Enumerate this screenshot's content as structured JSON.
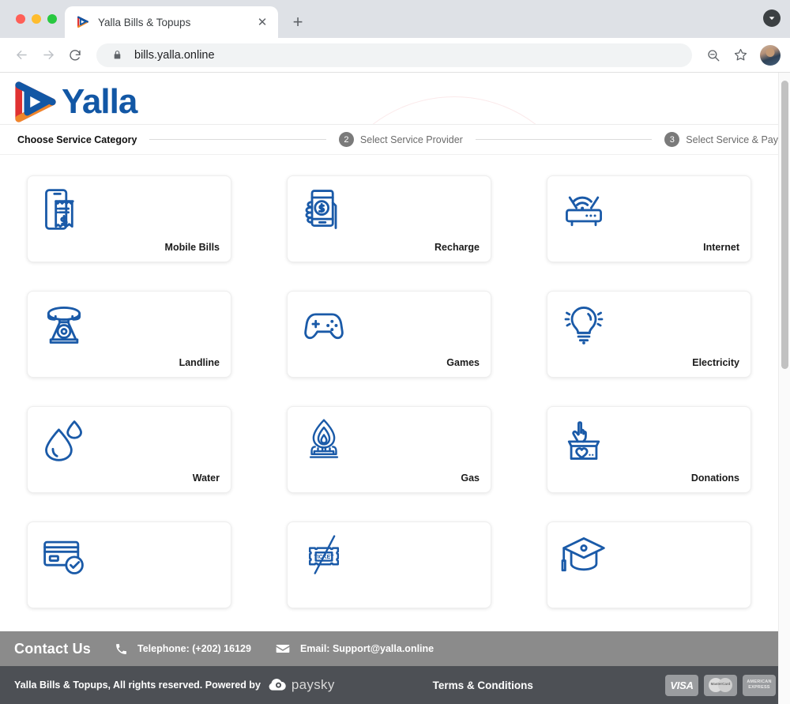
{
  "browser": {
    "tab": {
      "title": "Yalla Bills & Topups",
      "favicon": "yalla-play-icon",
      "close_label": "✕"
    },
    "new_tab_label": "+",
    "tabstrip_menu_icon": "chevron-down-icon",
    "toolbar": {
      "back_icon": "arrow-left-icon",
      "forward_icon": "arrow-right-icon",
      "reload_icon": "reload-icon",
      "lock_icon": "lock-icon",
      "url": "bills.yalla.online",
      "zoom_icon": "search-minus-icon",
      "bookmark_icon": "star-icon",
      "profile_icon": "avatar"
    }
  },
  "site": {
    "logo_text": "Yalla",
    "logo_mark": "yalla-play-icon"
  },
  "stepper": {
    "steps": [
      {
        "number": "",
        "label": "Choose Service Category",
        "active": true
      },
      {
        "number": "2",
        "label": "Select Service Provider",
        "active": false
      },
      {
        "number": "3",
        "label": "Select Service & Pay",
        "active": false
      }
    ]
  },
  "categories": [
    {
      "label": "Mobile Bills",
      "icon": "mobile-bill-icon"
    },
    {
      "label": "Recharge",
      "icon": "hand-phone-money-icon"
    },
    {
      "label": "Internet",
      "icon": "wifi-router-icon"
    },
    {
      "label": "Landline",
      "icon": "landline-phone-icon"
    },
    {
      "label": "Games",
      "icon": "gamepad-icon"
    },
    {
      "label": "Electricity",
      "icon": "lightbulb-icon"
    },
    {
      "label": "Water",
      "icon": "water-drop-icon"
    },
    {
      "label": "Gas",
      "icon": "gas-flame-icon"
    },
    {
      "label": "Donations",
      "icon": "donation-box-icon"
    },
    {
      "label": "",
      "icon": "credit-card-check-icon"
    },
    {
      "label": "",
      "icon": "ticket-icon"
    },
    {
      "label": "",
      "icon": "graduation-cap-icon"
    }
  ],
  "contact": {
    "title": "Contact Us",
    "phone_icon": "phone-icon",
    "phone": "Telephone: (+202) 16129",
    "email_icon": "envelope-icon",
    "email": "Email: Support@yalla.online"
  },
  "footer": {
    "copyright": "Yalla Bills & Topups, All rights reserved. Powered by",
    "powered_by": "paysky",
    "powered_by_icon": "paysky-cloud-icon",
    "terms": "Terms & Conditions",
    "payment_cards": [
      {
        "name": "VISA",
        "icon": "visa-icon"
      },
      {
        "name": "MasterCard",
        "icon": "mastercard-icon"
      },
      {
        "name": "AMERICAN EXPRESS",
        "icon": "amex-icon"
      }
    ]
  },
  "ticket_word": "TICKET"
}
